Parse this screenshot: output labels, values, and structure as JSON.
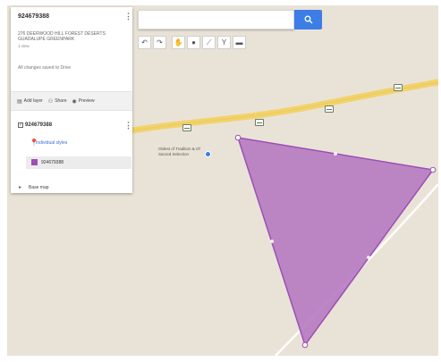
{
  "search": {
    "placeholder": "",
    "button_icon": "search-icon"
  },
  "toolbar": {
    "tools": [
      "undo-icon",
      "redo-icon",
      "hand-icon",
      "marker-icon",
      "line-icon",
      "filter-icon",
      "ruler-icon"
    ]
  },
  "panel": {
    "title": "924679388",
    "description": "276 DEERWOOD HILL FOREST DESERTS GUADALUPE GREENPARK",
    "meta": "1 view",
    "save_status": "All changes saved to Drive",
    "actions": {
      "add_layer": "Add layer",
      "share": "Share",
      "preview": "Preview"
    },
    "layer": {
      "title": "924679388",
      "style_link": "Individual styles",
      "feature_name": "924679388"
    },
    "base_map": "Base map"
  },
  "map": {
    "place_label": "Oldest of Tradition & Of Sacred Selection",
    "polygon_color": "#b67ac2",
    "road_color": "#f2d36b"
  }
}
